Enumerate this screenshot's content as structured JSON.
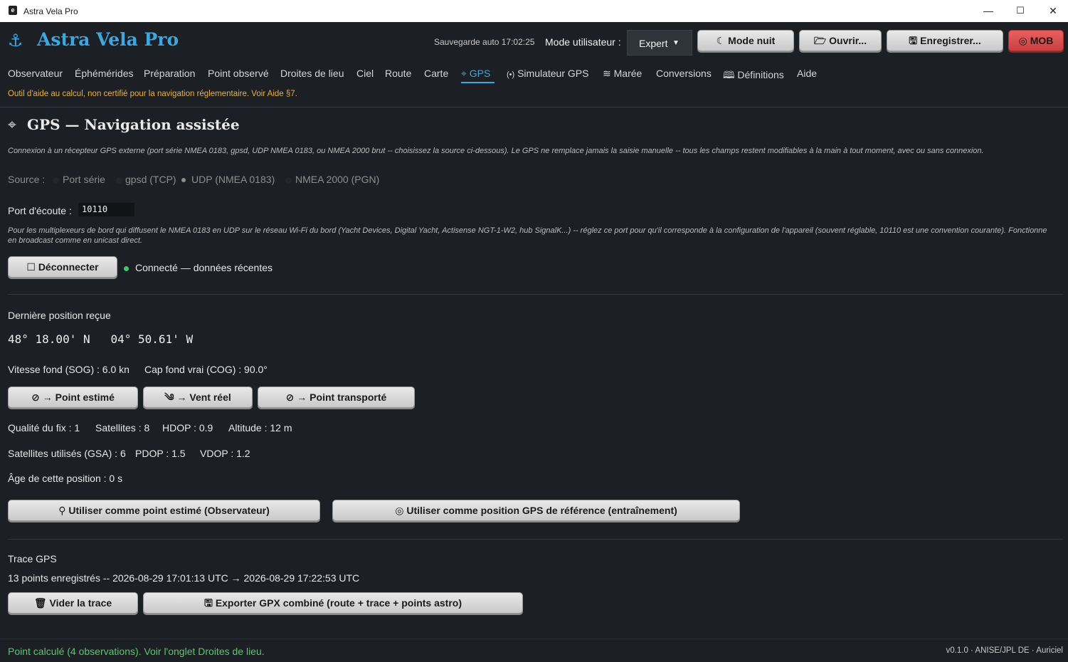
{
  "window": {
    "title": "Astra Vela Pro",
    "minimize": "—",
    "maximize": "☐",
    "close": "✕"
  },
  "header": {
    "app_name": "Astra Vela Pro",
    "autosave": "Sauvegarde auto 17:02:25",
    "mode_label": "Mode utilisateur :",
    "mode_value": "Expert",
    "buttons": {
      "night": "Mode nuit",
      "open": "Ouvrir...",
      "save": "Enregistrer...",
      "mob": "MOB"
    }
  },
  "tabs": [
    "Observateur",
    "Éphémérides",
    "Préparation",
    "Point observé",
    "Droites de lieu",
    "Ciel",
    "Route",
    "Carte",
    "GPS",
    "Simulateur GPS",
    "Marée",
    "Conversions",
    "Définitions",
    "Aide"
  ],
  "active_tab": "GPS",
  "warning": "Outil d'aide au calcul, non certifié pour la navigation réglementaire. Voir Aide §7.",
  "page": {
    "title": "GPS — Navigation assistée",
    "intro": "Connexion à un récepteur GPS externe (port série NMEA 0183, gpsd, UDP NMEA 0183, ou NMEA 2000 brut -- choisissez la source ci-dessous). Le GPS ne remplace jamais la saisie manuelle -- tous les champs restent modifiables à la main à tout moment, avec ou sans connexion.",
    "source_label": "Source :",
    "sources": [
      "Port série",
      "gpsd (TCP)",
      "UDP (NMEA 0183)",
      "NMEA 2000 (PGN)"
    ],
    "selected_source": "UDP (NMEA 0183)",
    "port_label": "Port d'écoute :",
    "port_value": "10110",
    "port_note": "Pour les multiplexeurs de bord qui diffusent le NMEA 0183 en UDP sur le réseau Wi-Fi du bord (Yacht Devices, Digital Yacht, Actisense NGT-1-W2, hub SignalK...) -- réglez ce port pour qu'il corresponde à la configuration de l'appareil (souvent réglable, 10110 est une convention courante). Fonctionne en broadcast comme en unicast direct.",
    "disconnect_button": "Déconnecter",
    "connection_status": "Connecté — données récentes",
    "last_position_label": "Dernière position reçue",
    "position": "48° 18.00' N   04° 50.61' W",
    "sog": "Vitesse fond (SOG) : 6.0 kn",
    "cog": "Cap fond vrai (COG) : 90.0°",
    "action_buttons": {
      "dr": "→ Point estimé",
      "wind": "→ Vent réel",
      "transfer": "→ Point transporté"
    },
    "fix_quality": "Qualité du fix : 1",
    "satellites": "Satellites : 8",
    "hdop": "HDOP : 0.9",
    "altitude": "Altitude : 12 m",
    "gsa_sats": "Satellites utilisés (GSA) : 6",
    "pdop": "PDOP : 1.5",
    "vdop": "VDOP : 1.2",
    "age": "Âge de cette position : 0 s",
    "use_dr_button": "Utiliser comme point estimé (Observateur)",
    "use_ref_button": "Utiliser comme position GPS de référence (entraînement)",
    "track_label": "Trace GPS",
    "track_info": "13 points enregistrés -- 2026-08-29 17:01:13 UTC → 2026-08-29 17:22:53 UTC",
    "clear_track_button": "Vider la trace",
    "export_button": "Exporter GPX combiné (route + trace + points astro)"
  },
  "statusbar": {
    "message": "Point calculé (4 observations). Voir l'onglet Droites de lieu.",
    "version": "v0.1.0 · ANISE/JPL DE · Auriciel"
  },
  "colors": {
    "accent": "#3ea7e0",
    "warning": "#e8b04a",
    "ok": "#5dc66f",
    "mob": "#d94f4f",
    "background": "#1c1f24"
  }
}
